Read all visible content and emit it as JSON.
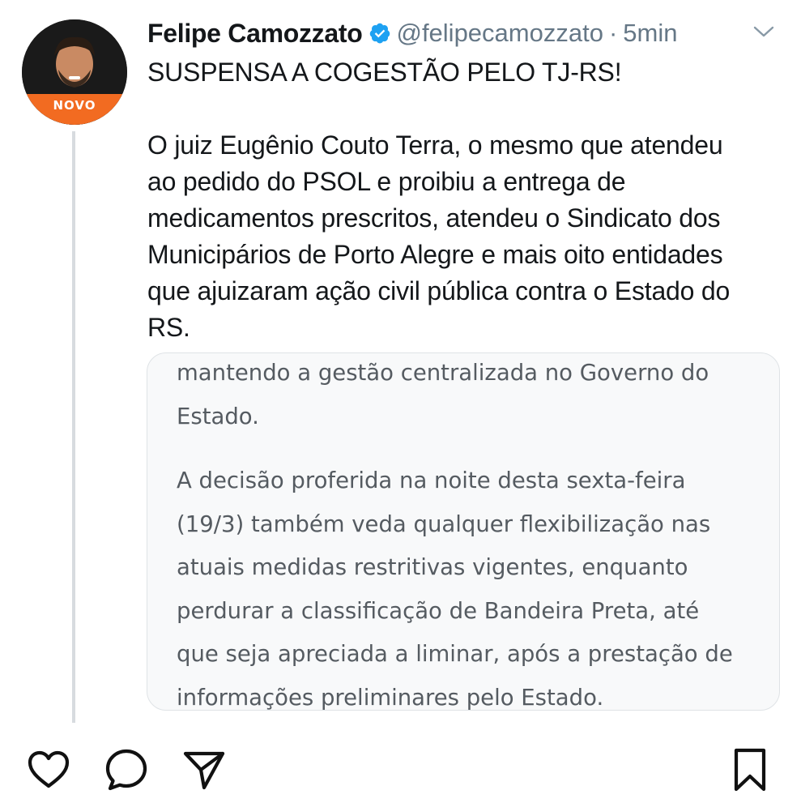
{
  "author": {
    "name": "Felipe Camozzato",
    "handle": "@felipecamozzato",
    "separator": "·",
    "time": "5min",
    "avatar_badge": "NOVO",
    "verified": true
  },
  "tweet": {
    "headline": "SUSPENSA A COGESTÃO PELO TJ-RS!",
    "body_lines": [
      "O juiz Eugênio Couto Terra, o mesmo que atendeu",
      "ao pedido do PSOL e proibiu a entrega de",
      "medicamentos prescritos, atendeu o Sindicato dos",
      "Municipários de Porto Alegre e mais oito entidades",
      "que ajuizaram ação civil pública contra o Estado do",
      "RS."
    ]
  },
  "quoted_image": {
    "para1_lines": [
      "mantendo a gestão centralizada no Governo do",
      "Estado."
    ],
    "para2_lines": [
      "A decisão proferida na noite desta sexta-feira",
      "(19/3) também veda qualquer flexibilização nas",
      "atuais medidas restritivas vigentes, enquanto",
      "perdurar a classificação de Bandeira Preta, até",
      "que seja apreciada a liminar, após a prestação de",
      "informações preliminares pelo Estado."
    ]
  },
  "icons": {
    "verified": "verified-badge-icon",
    "caret": "chevron-down-icon",
    "like": "heart-icon",
    "reply": "comment-icon",
    "share": "send-icon",
    "save": "bookmark-icon"
  },
  "colors": {
    "text": "#14171a",
    "muted": "#657786",
    "verified_blue": "#1da1f2",
    "avatar_band": "#f26b21"
  }
}
